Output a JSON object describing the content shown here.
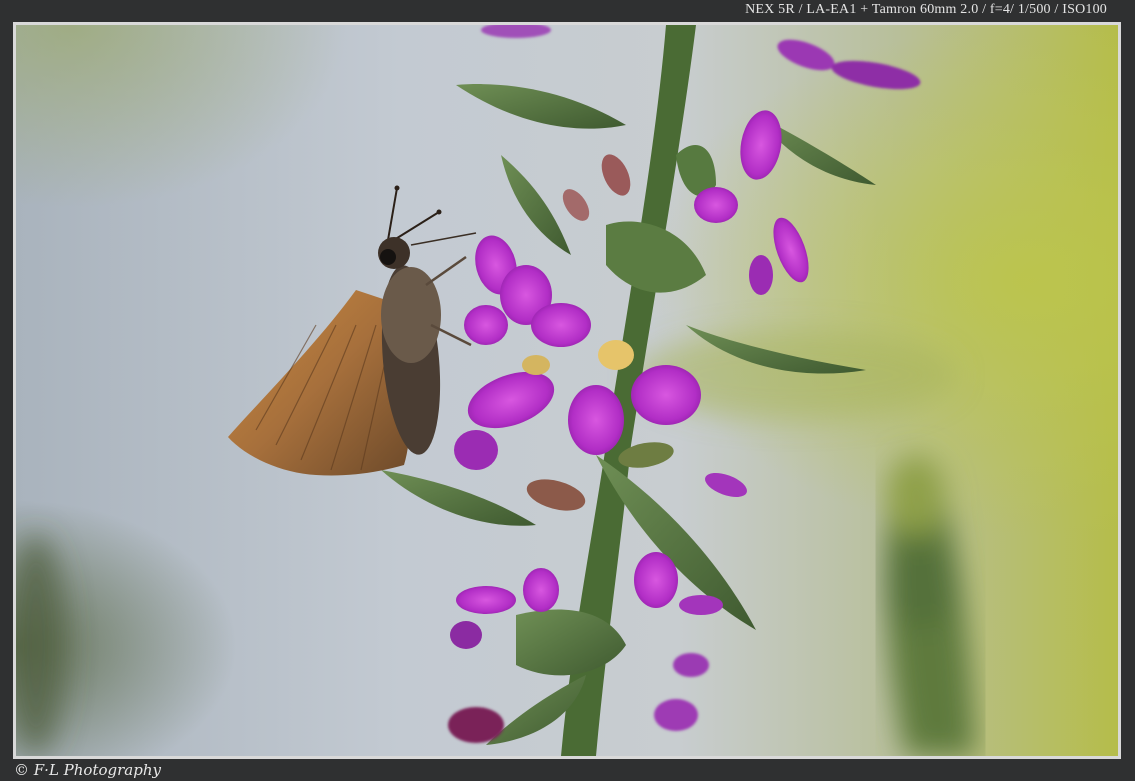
{
  "exif": {
    "text": "NEX 5R / LA-EA1 + Tamron 60mm 2.0 / f=4/ 1/500 / ISO100"
  },
  "credit": {
    "text": "© F·L Photography"
  },
  "photo": {
    "subject": "skipper butterfly on purple loosestrife flower spike",
    "colors": {
      "background_blue": "#b7c0ca",
      "background_green": "#b9c25a",
      "petal": "#b430c8",
      "petal_dark": "#7a1a8e",
      "leaf": "#4f6e3a",
      "wing": "#b0763a",
      "frame": "#2f3031"
    }
  }
}
